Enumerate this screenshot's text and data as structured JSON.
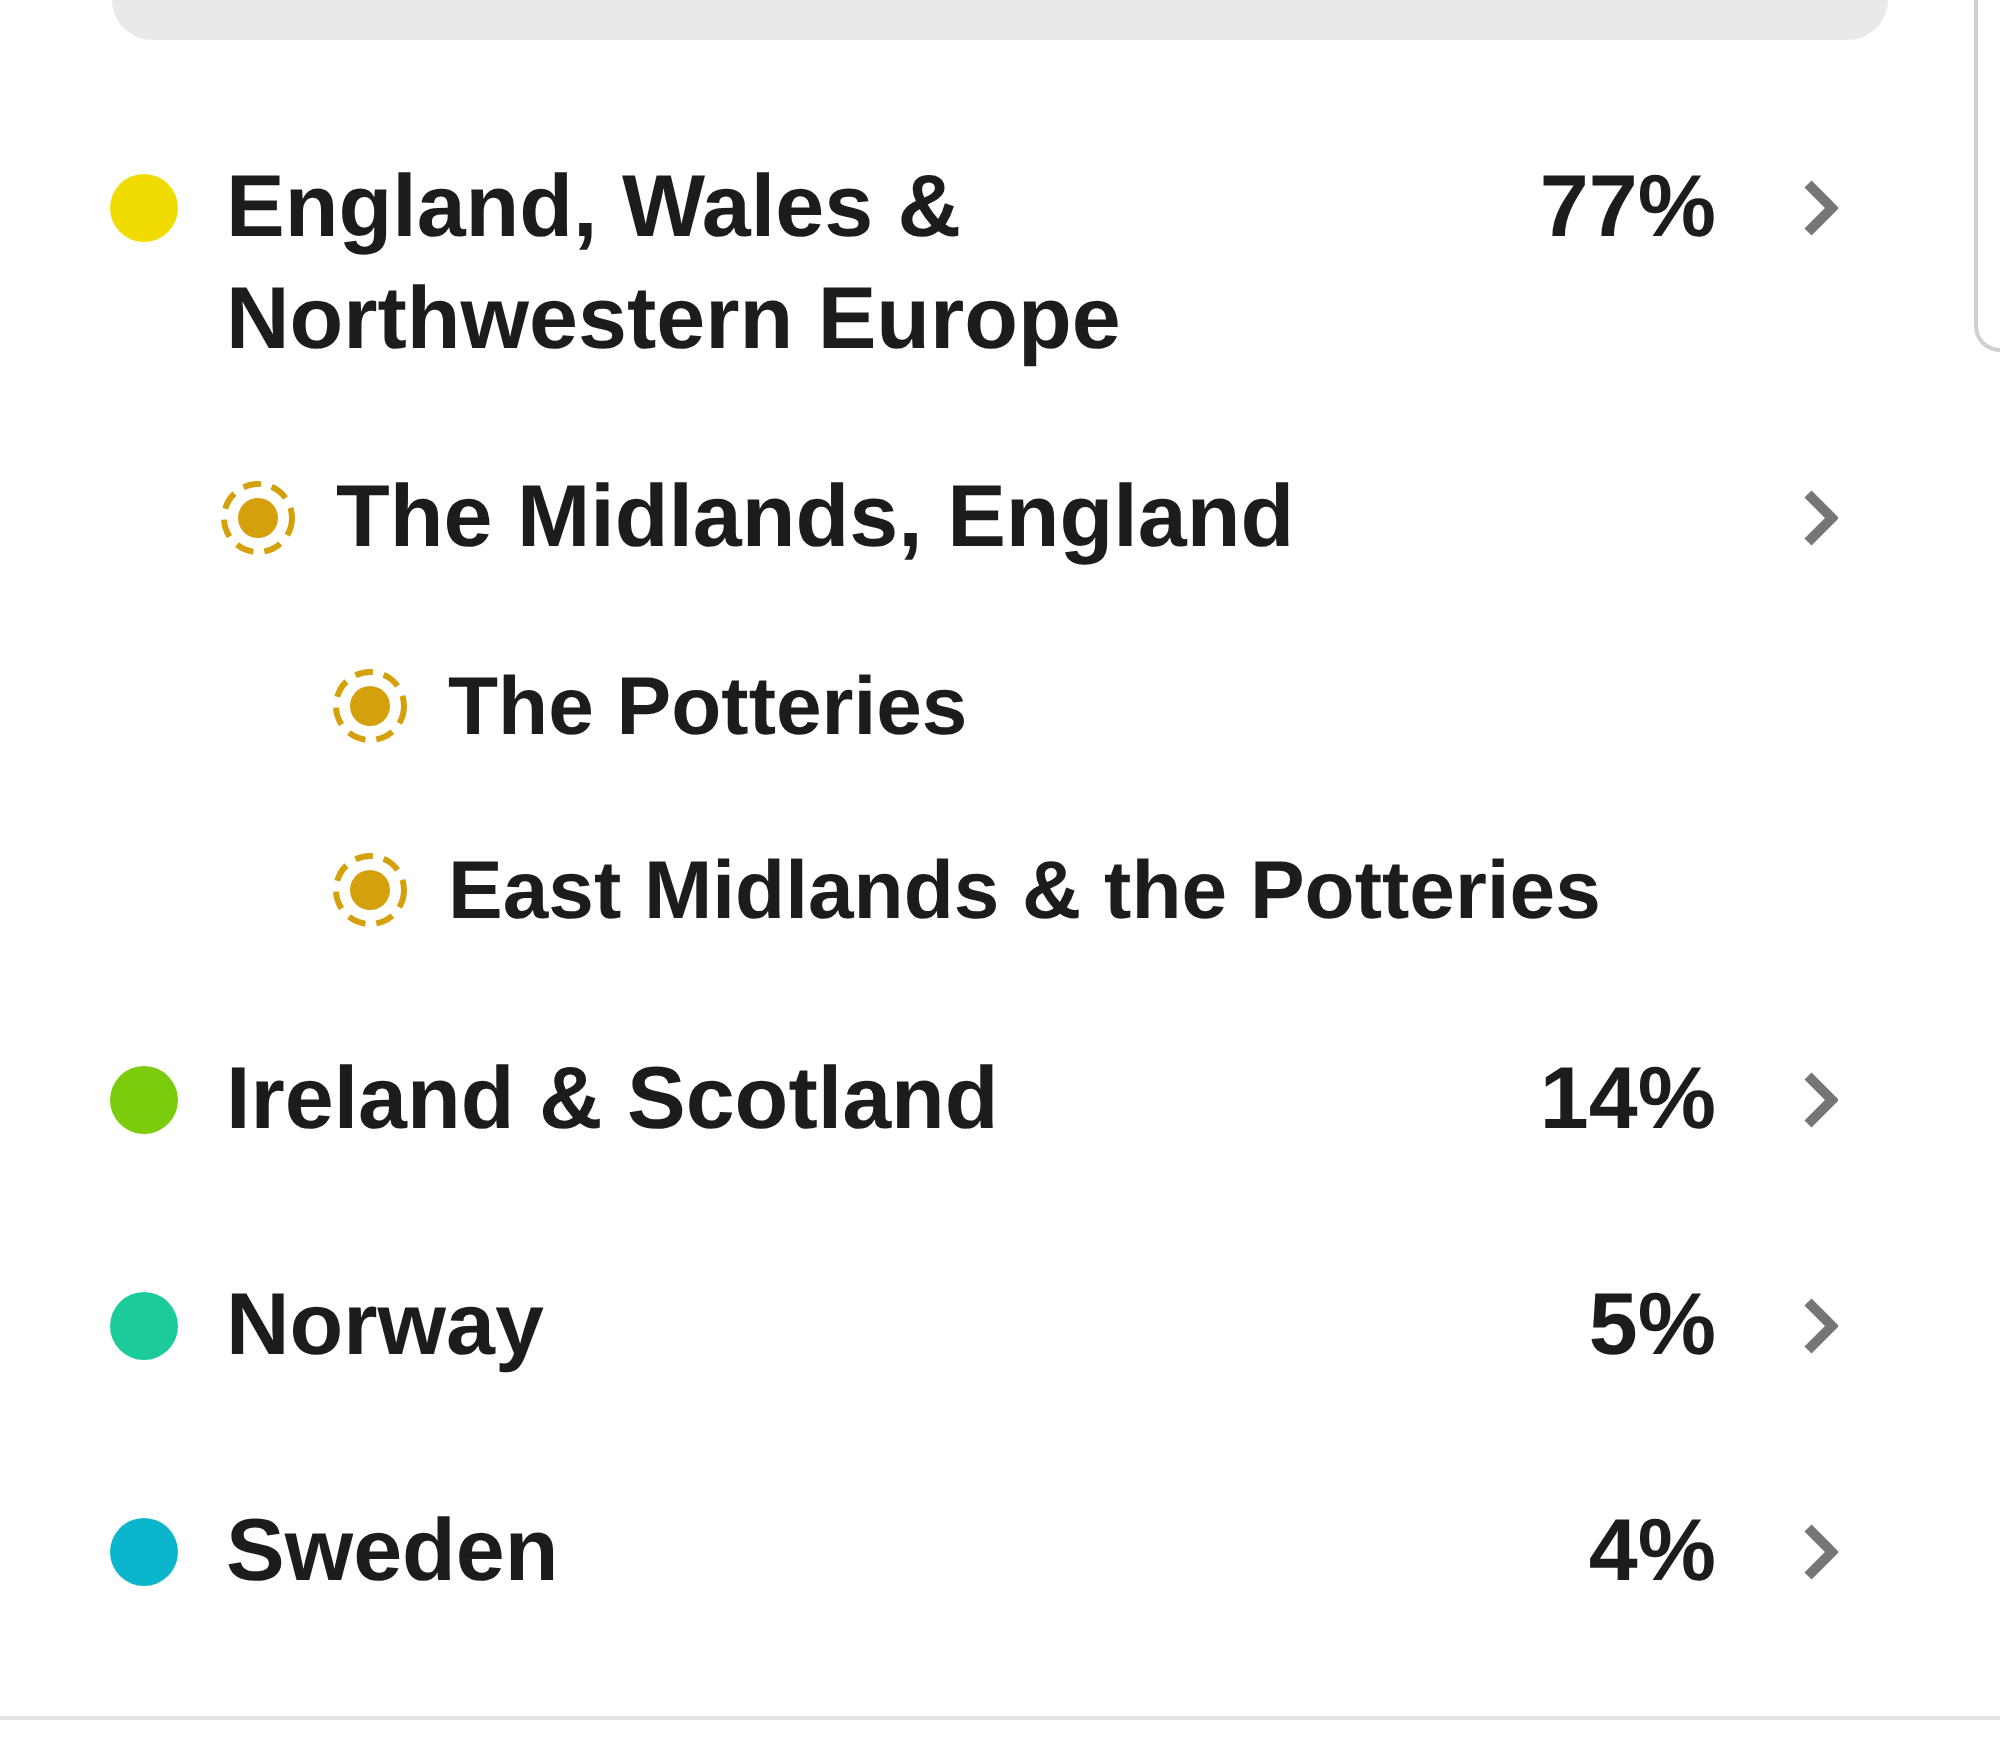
{
  "regions": [
    {
      "kind": "region",
      "name": "England, Wales & Northwestern Europe",
      "percent": "77%",
      "color": "#f0dc00",
      "navigable": true,
      "children": [
        {
          "kind": "community",
          "name": "The Midlands, England",
          "color": "#d4a00c",
          "navigable": true,
          "children": [
            {
              "kind": "community",
              "name": "The Potteries",
              "color": "#d4a00c",
              "navigable": false
            },
            {
              "kind": "community",
              "name": "East Midlands & the Potteries",
              "color": "#d4a00c",
              "navigable": false
            }
          ]
        }
      ]
    },
    {
      "kind": "region",
      "name": "Ireland & Scotland",
      "percent": "14%",
      "color": "#7acc0c",
      "navigable": true
    },
    {
      "kind": "region",
      "name": "Norway",
      "percent": "5%",
      "color": "#1ccb9a",
      "navigable": true
    },
    {
      "kind": "region",
      "name": "Sweden",
      "percent": "4%",
      "color": "#0bb6cc",
      "navigable": true
    }
  ]
}
